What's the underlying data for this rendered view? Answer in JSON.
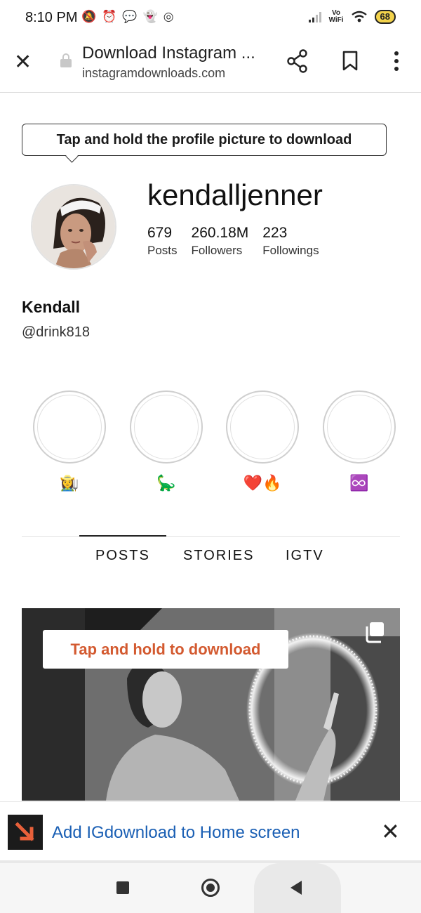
{
  "status_bar": {
    "time": "8:10 PM",
    "left_icons": [
      "mute-icon",
      "alarm-icon",
      "message-icon",
      "snapchat-icon",
      "instagram-icon"
    ],
    "vowifi_top": "Vo",
    "vowifi_bottom": "WiFi",
    "battery": "68"
  },
  "browser": {
    "title": "Download Instagram ...",
    "url": "instagramdownloads.com"
  },
  "profile_tip": "Tap and hold the profile picture to download",
  "profile": {
    "username": "kendalljenner",
    "stats": [
      {
        "value": "679",
        "label": "Posts"
      },
      {
        "value": "260.18M",
        "label": "Followers"
      },
      {
        "value": "223",
        "label": "Followings"
      }
    ],
    "display_name": "Kendall",
    "bio": "@drink818"
  },
  "highlights": [
    {
      "label": "👩‍🌾"
    },
    {
      "label": "🦕"
    },
    {
      "label": "❤️🔥"
    },
    {
      "label": "♾️"
    }
  ],
  "tabs": [
    "POSTS",
    "STORIES",
    "IGTV"
  ],
  "active_tab": "POSTS",
  "post_tip": "Tap and hold to download",
  "add_to_home": {
    "text": "Add IGdownload to Home screen"
  },
  "colors": {
    "link_blue": "#1a5fb4",
    "download_orange": "#d35a30"
  }
}
